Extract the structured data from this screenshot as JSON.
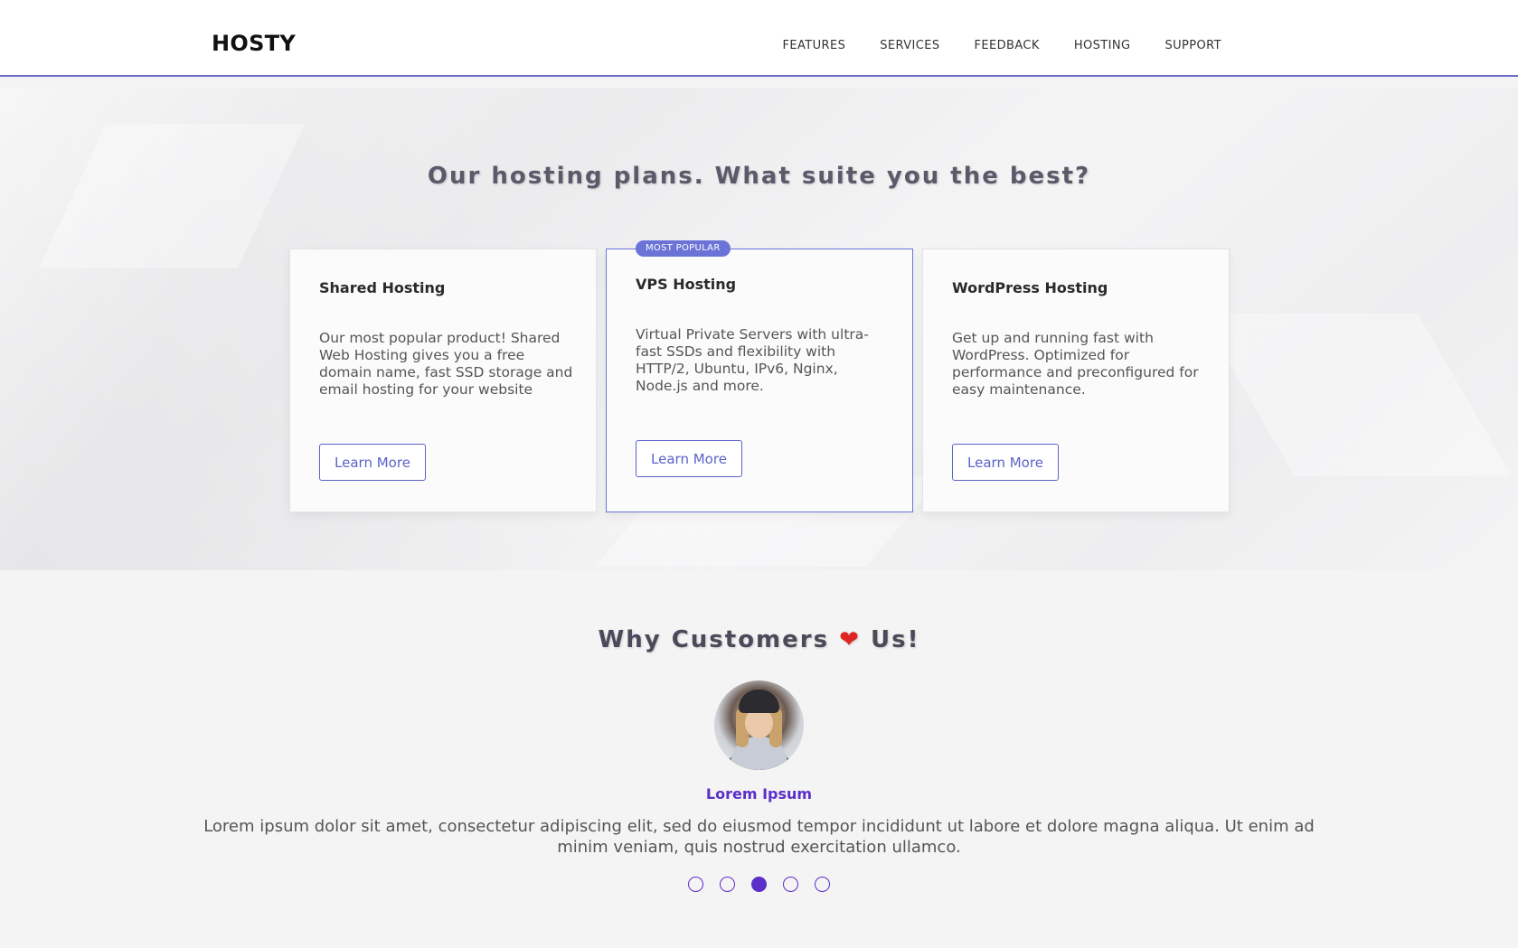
{
  "brand": "HOSTY",
  "nav": {
    "items": [
      "FEATURES",
      "SERVICES",
      "FEEDBACK",
      "HOSTING",
      "SUPPORT"
    ]
  },
  "plans": {
    "title": "Our hosting plans. What suite you the best?",
    "cards": [
      {
        "title": "Shared Hosting",
        "description": "Our most popular product! Shared Web Hosting gives you a free domain name, fast SSD storage and email hosting for your website",
        "button": "Learn More"
      },
      {
        "badge": "MOST POPULAR",
        "title": "VPS Hosting",
        "description": "Virtual Private Servers with ultra-fast SSDs and flexibility with HTTP/2, Ubuntu, IPv6, Nginx, Node.js and more.",
        "button": "Learn More"
      },
      {
        "title": "WordPress Hosting",
        "description": "Get up and running fast with WordPress. Optimized for performance and preconfigured for easy maintenance.",
        "button": "Learn More"
      }
    ]
  },
  "testimonials": {
    "title_before": "Why Customers",
    "heart": "❤",
    "title_after": "Us!",
    "name": "Lorem Ipsum",
    "quote": "Lorem ipsum dolor sit amet, consectetur adipiscing elit, sed do eiusmod tempor incididunt ut labore et dolore magna aliqua. Ut enim ad minim veniam, quis nostrud exercitation ullamco.",
    "dots_count": 5,
    "active_dot": 3
  },
  "colors": {
    "accent": "#5b2fc9",
    "button": "#5a63c9",
    "badge": "#6b74d6",
    "heart": "#e02424"
  }
}
